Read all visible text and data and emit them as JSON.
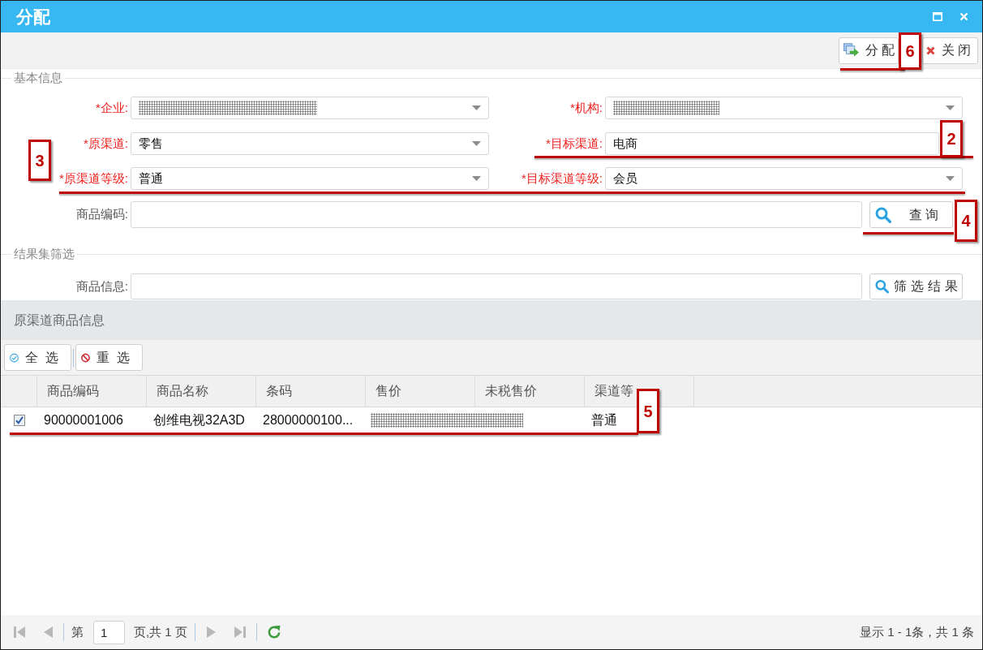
{
  "window": {
    "title": "分配"
  },
  "toolbar": {
    "buttons": [
      {
        "kind": "assign",
        "label": "分配",
        "callout": "6",
        "underlined": true
      },
      {
        "kind": "close",
        "label": "关闭"
      }
    ]
  },
  "basic_info": {
    "legend": "基本信息",
    "rows": [
      {
        "fields": [
          {
            "label": "*企业:",
            "required": true,
            "redacted": true,
            "dropdown": true
          },
          {
            "label": "*机构:",
            "required": true,
            "redacted": true,
            "dropdown": true
          }
        ]
      },
      {
        "fields": [
          {
            "label": "*原渠道:",
            "required": true,
            "value": "零售",
            "dropdown": true
          },
          {
            "label": "*目标渠道:",
            "required": true,
            "value": "电商",
            "dropdown": false,
            "callout": "2",
            "underlined": true
          }
        ]
      },
      {
        "fields": [
          {
            "label": "*原渠道等级:",
            "required": true,
            "value": "普通",
            "dropdown": true
          },
          {
            "label": "*目标渠道等级:",
            "required": true,
            "value": "会员",
            "dropdown": true
          }
        ],
        "callout": "3",
        "underlined": true
      }
    ],
    "search": {
      "label": "商品编码:",
      "button": "查询",
      "callout": "4",
      "underlined": true
    }
  },
  "result_filter": {
    "legend": "结果集筛选",
    "label": "商品信息:",
    "button": "筛选结果"
  },
  "grid": {
    "title": "原渠道商品信息",
    "buttons": [
      {
        "kind": "select_all",
        "label": "全选"
      },
      {
        "kind": "reset",
        "label": "重选"
      }
    ],
    "columns": [
      "商品编码",
      "商品名称",
      "条码",
      "售价",
      "未税售价",
      "渠道等"
    ],
    "rows": [
      {
        "checked": true,
        "cells": [
          {
            "kind": "text",
            "text": "90000001006"
          },
          {
            "kind": "text",
            "text": "创维电视32A3D"
          },
          {
            "kind": "text",
            "text": "28000000100..."
          },
          {
            "kind": "redacted"
          },
          {
            "kind": "redacted"
          },
          {
            "kind": "text",
            "text": "普通"
          }
        ],
        "callout": "5",
        "underlined": true
      }
    ]
  },
  "pager": {
    "nav_before": [
      {
        "kind": "first",
        "disabled": true
      },
      {
        "kind": "prev",
        "disabled": true
      }
    ],
    "prefix": "第",
    "page": "1",
    "suffix": "页,共 1 页",
    "nav_after": [
      {
        "kind": "next",
        "disabled": true
      },
      {
        "kind": "last",
        "disabled": true
      }
    ],
    "summary": "显示 1 - 1条，共 1 条"
  }
}
